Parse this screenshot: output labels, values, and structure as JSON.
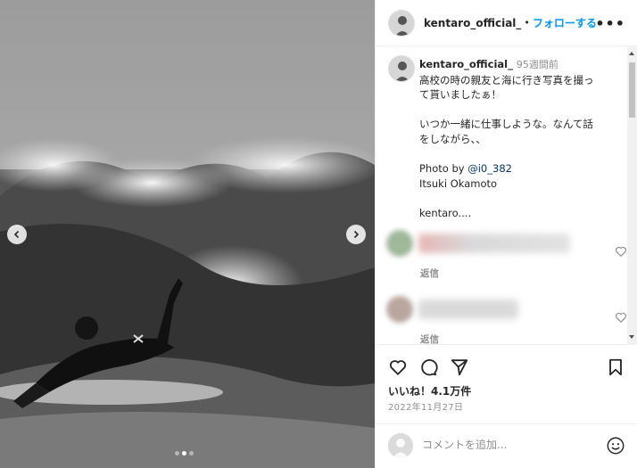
{
  "header": {
    "username": "kentaro_official_",
    "separator": "•",
    "follow_label": "フォローする",
    "more_label": "•••"
  },
  "caption": {
    "username": "kentaro_official_",
    "time": "95週間前",
    "lines": [
      "高校の時の親友と海に行き写真を撮っ",
      "て貰いましたぁ！",
      "",
      "いつか一緒に仕事しような。なんて話",
      "をしながら、、",
      "",
      "Photo by ",
      "Itsuki Okamoto",
      "",
      "kentaro...."
    ],
    "mention": "@i0_382"
  },
  "comments": [
    {
      "reply_label": "返信"
    },
    {
      "reply_label": "返信"
    }
  ],
  "actions": {
    "likes": "いいね！4.1万件",
    "date": "2022年11月27日"
  },
  "comment_bar": {
    "placeholder": "コメントを追加..."
  },
  "carousel": {
    "count": 3,
    "active_index": 1
  },
  "colors": {
    "accent": "#0095f6",
    "text": "#262626",
    "muted": "#8e8e8e"
  }
}
